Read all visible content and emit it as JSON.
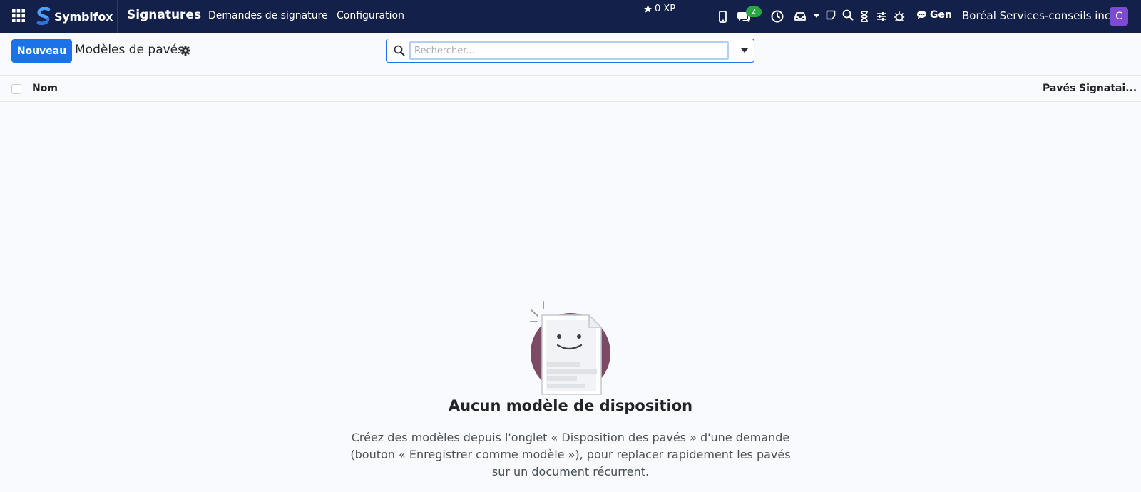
{
  "navbar": {
    "brand_name": "Symbifox",
    "app_title": "Signatures",
    "menu": [
      {
        "label": "Demandes de signature"
      },
      {
        "label": "Configuration"
      }
    ],
    "xp_label": "0 XP",
    "messages_count": "2",
    "gen_label": "Gen",
    "company": "Boréal Services-conseils inc.",
    "avatar_initial": "C",
    "icons": [
      "apps-grid-icon",
      "mobile-icon",
      "chat-icon",
      "clock-icon",
      "inbox-icon",
      "caret-down-icon",
      "note-icon",
      "search-icon",
      "hourglass-icon",
      "sliders-icon",
      "bug-icon",
      "comment-icon"
    ],
    "colors": {
      "background": "#13204a",
      "badge": "#28a745",
      "avatar": "#7c4bd1"
    }
  },
  "control_panel": {
    "new_button": "Nouveau",
    "title": "Modèles de pavés",
    "search_placeholder": "Rechercher..."
  },
  "list": {
    "columns": [
      {
        "label": "Nom"
      },
      {
        "label": "Pavés"
      },
      {
        "label": "Signatai..."
      }
    ],
    "rows": []
  },
  "empty_state": {
    "title": "Aucun modèle de disposition",
    "text": "Créez des modèles depuis l'onglet « Disposition des pavés » d'une demande (bouton « Enregistrer comme modèle »), pour replacer rapidement les pavés sur un document récurrent."
  },
  "accent_color": "#1a73e8"
}
